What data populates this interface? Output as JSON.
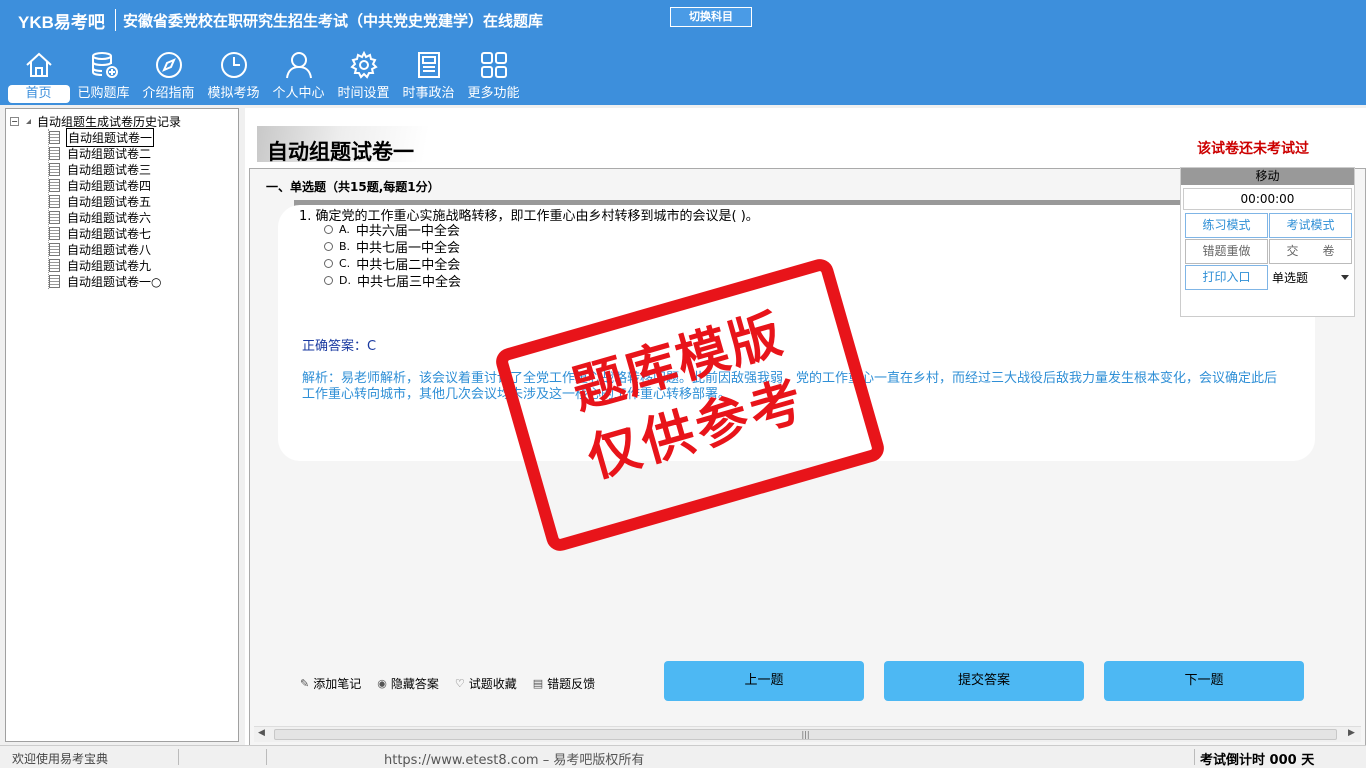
{
  "header": {
    "logo": "YKB易考吧",
    "title": "安徽省委党校在职研究生招生考试（中共党史党建学）在线题库",
    "switch_label": "切换科目",
    "nav": [
      {
        "label": "首页",
        "icon": "home-icon"
      },
      {
        "label": "已购题库",
        "icon": "database-icon"
      },
      {
        "label": "介绍指南",
        "icon": "compass-icon"
      },
      {
        "label": "模拟考场",
        "icon": "clock-icon"
      },
      {
        "label": "个人中心",
        "icon": "user-icon"
      },
      {
        "label": "时间设置",
        "icon": "gear-icon"
      },
      {
        "label": "时事政治",
        "icon": "news-icon"
      },
      {
        "label": "更多功能",
        "icon": "grid-icon"
      }
    ]
  },
  "sidebar": {
    "root_label": "自动组题生成试卷历史记录",
    "items": [
      "自动组题试卷一",
      "自动组题试卷二",
      "自动组题试卷三",
      "自动组题试卷四",
      "自动组题试卷五",
      "自动组题试卷六",
      "自动组题试卷七",
      "自动组题试卷八",
      "自动组题试卷九",
      "自动组题试卷一○"
    ]
  },
  "main": {
    "paper_title": "自动组题试卷一",
    "exam_status": "该试卷还未考试过",
    "section_head": "一、单选题（共15题,每题1分）",
    "question": {
      "text": "1. 确定党的工作重心实施战略转移，即工作重心由乡村转移到城市的会议是( )。",
      "options": [
        {
          "letter": "A.",
          "text": "中共六届一中全会"
        },
        {
          "letter": "B.",
          "text": "中共七届一中全会"
        },
        {
          "letter": "C.",
          "text": "中共七届二中全会"
        },
        {
          "letter": "D.",
          "text": "中共七届三中全会"
        }
      ],
      "answer": "正确答案：C",
      "analysis": "解析：易老师解析，该会议着重讨论了全党工作重心战略转移问题。此前因敌强我弱，党的工作重心一直在乡村，而经过三大战役后敌我力量发生根本变化，会议确定此后工作重心转向城市，其他几次会议均未涉及这一核心的工作重心转移部署。"
    },
    "tools": [
      {
        "icon": "pencil-icon",
        "label": "添加笔记"
      },
      {
        "icon": "eye-icon",
        "label": "隐藏答案"
      },
      {
        "icon": "heart-icon",
        "label": "试题收藏"
      },
      {
        "icon": "feedback-icon",
        "label": "错题反馈"
      }
    ],
    "buttons": {
      "prev": "上一题",
      "submit": "提交答案",
      "next": "下一题"
    }
  },
  "rpanel": {
    "move_label": "移动",
    "timer": "00:00:00",
    "practice_mode": "练习模式",
    "exam_mode": "考试模式",
    "redo_wrong": "错题重做",
    "submit_paper": "交　　卷",
    "print_entry": "打印入口",
    "type_select": "单选题"
  },
  "stamp": {
    "line1": "题库模版",
    "line2": "仅供参考"
  },
  "statusbar": {
    "welcome": "欢迎使用易考宝典",
    "copyright": "https://www.etest8.com – 易考吧版权所有",
    "countdown": "考试倒计时 000 天"
  },
  "colors": {
    "header_bg": "#3d8fdc",
    "button_blue": "#4db8f3",
    "status_red": "#cc0000",
    "stamp_red": "#e8141a"
  }
}
